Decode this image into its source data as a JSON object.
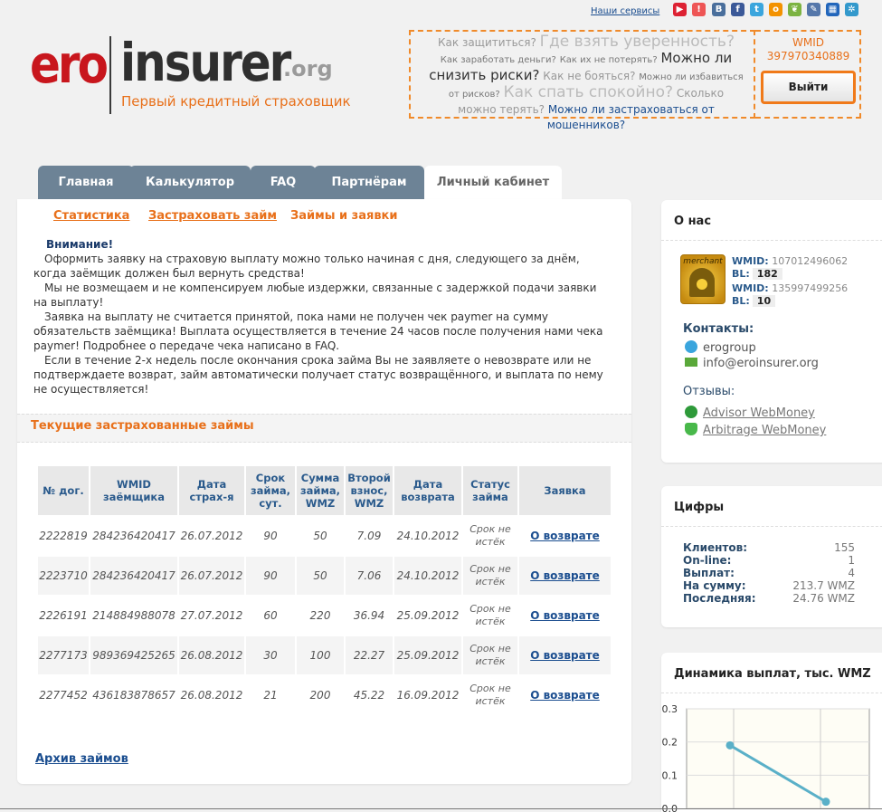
{
  "header": {
    "services_link": "Наши сервисы",
    "social_icons": [
      "youtube-icon",
      "hint-icon",
      "vk-icon",
      "facebook-icon",
      "twitter-icon",
      "odnoklassniki-icon",
      "mirtesen-icon",
      "bookmark-icon",
      "myspace-icon",
      "liveinternet-icon"
    ],
    "logo": {
      "ero": "ero",
      "insurer": "insurer",
      "org": ".org",
      "tagline": "Первый кредитный страховщик"
    },
    "questions": {
      "q1": "Как защититься?",
      "q2": "Где взять уверенность?",
      "q3": "Как заработать деньги?",
      "q4": "Как их не потерять?",
      "q5": "Можно ли",
      "q6": "снизить риски?",
      "q7": "Как не бояться?",
      "q8": "Можно ли избавиться",
      "q9": "от рисков?",
      "q10": "Как спать спокойно?",
      "q11": "Сколько",
      "q12": "можно терять?",
      "q13": "Можно ли застраховаться от мошенников?"
    },
    "wmid_label": "WMID",
    "wmid_value": "397970340889",
    "logout_label": "Выйти"
  },
  "tabs": [
    {
      "label": "Главная"
    },
    {
      "label": "Калькулятор"
    },
    {
      "label": "FAQ"
    },
    {
      "label": "Партнёрам"
    },
    {
      "label": "Личный кабинет"
    }
  ],
  "sublinks": [
    "Статистика",
    "Застраховать займ",
    "Займы и заявки"
  ],
  "notice": {
    "warning": "Внимание!",
    "p1": "Оформить заявку на страховую выплату можно только начиная с дня, следующего за днём, когда заёмщик должен был вернуть средства!",
    "p2": "Мы не возмещаем и не компенсируем любые издержки, связанные с задержкой подачи заявки на выплату!",
    "p3": "Заявка на выплату не считается принятой, пока нами не получен чек paymer на сумму обязательств заёмщика! Выплата осуществляется в течение 24 часов после получения нами чека paymer! Подробнее о передаче чека написано в FAQ.",
    "p4": "Если в течение 2-х недель после окончания срока займа Вы не заявляете о невозврате или не подтверждаете возврат, займ автоматически получает статус возвращённого, и выплата по нему не осуществляется!"
  },
  "current_title": "Текущие застрахованные займы",
  "table": {
    "headers": [
      "№ дог.",
      "WMID заёмщика",
      "Дата страх-я",
      "Срок займа, сут.",
      "Сумма займа, WMZ",
      "Второй взнос, WMZ",
      "Дата возврата",
      "Статус займа",
      "Заявка"
    ],
    "rows": [
      {
        "num": "2222819",
        "wmid": "284236420417",
        "date": "26.07.2012",
        "term": "90",
        "sum": "50",
        "second": "7.09",
        "ret": "24.10.2012",
        "status": "Срок не истёк",
        "action": "О возврате"
      },
      {
        "num": "2223710",
        "wmid": "284236420417",
        "date": "26.07.2012",
        "term": "90",
        "sum": "50",
        "second": "7.06",
        "ret": "24.10.2012",
        "status": "Срок не истёк",
        "action": "О возврате"
      },
      {
        "num": "2226191",
        "wmid": "214884988078",
        "date": "27.07.2012",
        "term": "60",
        "sum": "220",
        "second": "36.94",
        "ret": "25.09.2012",
        "status": "Срок не истёк",
        "action": "О возврате"
      },
      {
        "num": "2277173",
        "wmid": "989369425265",
        "date": "26.08.2012",
        "term": "30",
        "sum": "100",
        "second": "22.27",
        "ret": "25.09.2012",
        "status": "Срок не истёк",
        "action": "О возврате"
      },
      {
        "num": "2277452",
        "wmid": "436183878657",
        "date": "26.08.2012",
        "term": "21",
        "sum": "200",
        "second": "45.22",
        "ret": "16.09.2012",
        "status": "Срок не истёк",
        "action": "О возврате"
      }
    ]
  },
  "archive_link": "Архив займов",
  "about": {
    "title": "О нас",
    "merchant_label": "merchant",
    "wmid1_label": "WMID:",
    "wmid1": "107012496062",
    "bl1_label": "BL:",
    "bl1": "182",
    "wmid2_label": "WMID:",
    "wmid2": "135997499256",
    "bl2_label": "BL:",
    "bl2": "10",
    "contacts_title": "Контакты:",
    "skype": "erogroup",
    "email": "info@eroinsurer.org",
    "reviews_title": "Отзывы:",
    "review1": "Advisor WebMoney",
    "review2": "Arbitrage WebMoney"
  },
  "figures": {
    "title": "Цифры",
    "rows": [
      {
        "k": "Клиентов:",
        "v": "155"
      },
      {
        "k": "On-line:",
        "v": "1"
      },
      {
        "k": "Выплат:",
        "v": "4"
      },
      {
        "k": "На сумму:",
        "v": "213.7 WMZ"
      },
      {
        "k": "Последняя:",
        "v": "24.76 WMZ"
      }
    ]
  },
  "chart_title": "Динамика выплат, тыс. WMZ",
  "chart_data": {
    "type": "line",
    "title": "Динамика выплат, тыс. WMZ",
    "y_ticks": [
      "0.3",
      "0.2",
      "0.1",
      "0.0"
    ],
    "ylim": [
      0,
      0.3
    ],
    "series": [
      {
        "values": [
          0.19,
          0.02
        ]
      }
    ],
    "grid": true,
    "color": "#5ab0c8"
  },
  "colors": {
    "accent": "#e8701a",
    "tab": "#6d8396",
    "link": "#1a4d8f"
  }
}
